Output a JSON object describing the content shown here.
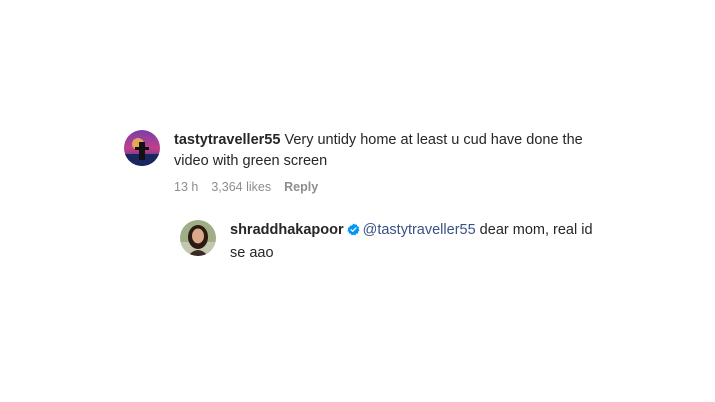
{
  "comments": [
    {
      "username": "tastytraveller55",
      "text": " Very untidy home at least u cud have done the video with green screen",
      "time": "13 h",
      "likes": "3,364 likes",
      "reply_label": "Reply",
      "avatar_icon": "profile-photo-sunset"
    }
  ],
  "reply": {
    "username": "shraddhakapoor",
    "verified_icon": "verified-badge-icon",
    "mention": "@tastytraveller55",
    "text": " dear mom, real id se aao",
    "avatar_icon": "profile-photo-woman"
  },
  "colors": {
    "mention": "#385185",
    "verified": "#0095f6",
    "meta": "#8e8e8e"
  }
}
